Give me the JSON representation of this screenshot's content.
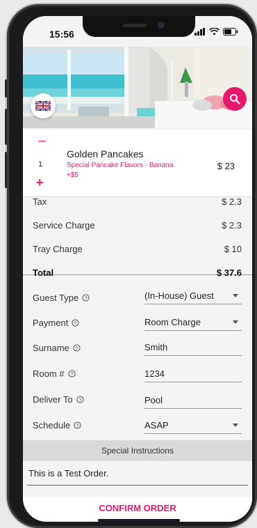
{
  "status_bar": {
    "time": "15:56"
  },
  "hero": {
    "flag_icon": "uk-flag-icon",
    "search_icon": "search-icon"
  },
  "cart_item": {
    "quantity": "1",
    "name": "Golden Pancakes",
    "option_line1": "Special Pancake Flavors - Banana",
    "option_line2": "+$5",
    "price": "$ 23"
  },
  "summary": {
    "tax_label": "Tax",
    "tax_amount": "$ 2.3",
    "service_label": "Service Charge",
    "service_amount": "$ 2.3",
    "tray_label": "Tray Charge",
    "tray_amount": "$ 10",
    "total_label": "Total",
    "total_amount": "$ 37.6"
  },
  "form": {
    "guest_type_label": "Guest Type",
    "guest_type_value": "(In-House) Guest",
    "payment_label": "Payment",
    "payment_value": "Room Charge",
    "surname_label": "Surname",
    "surname_value": "Smith",
    "room_label": "Room #",
    "room_value": "1234",
    "deliver_label": "Deliver To",
    "deliver_value": "Pool",
    "schedule_label": "Schedule",
    "schedule_value": "ASAP"
  },
  "instructions": {
    "header": "Special Instructions",
    "value": "This is a Test Order."
  },
  "confirm": {
    "label": "CONFIRM ORDER"
  },
  "colors": {
    "accent": "#e6196e",
    "background": "#f4f4f4",
    "section_header": "#d9d9d9"
  }
}
